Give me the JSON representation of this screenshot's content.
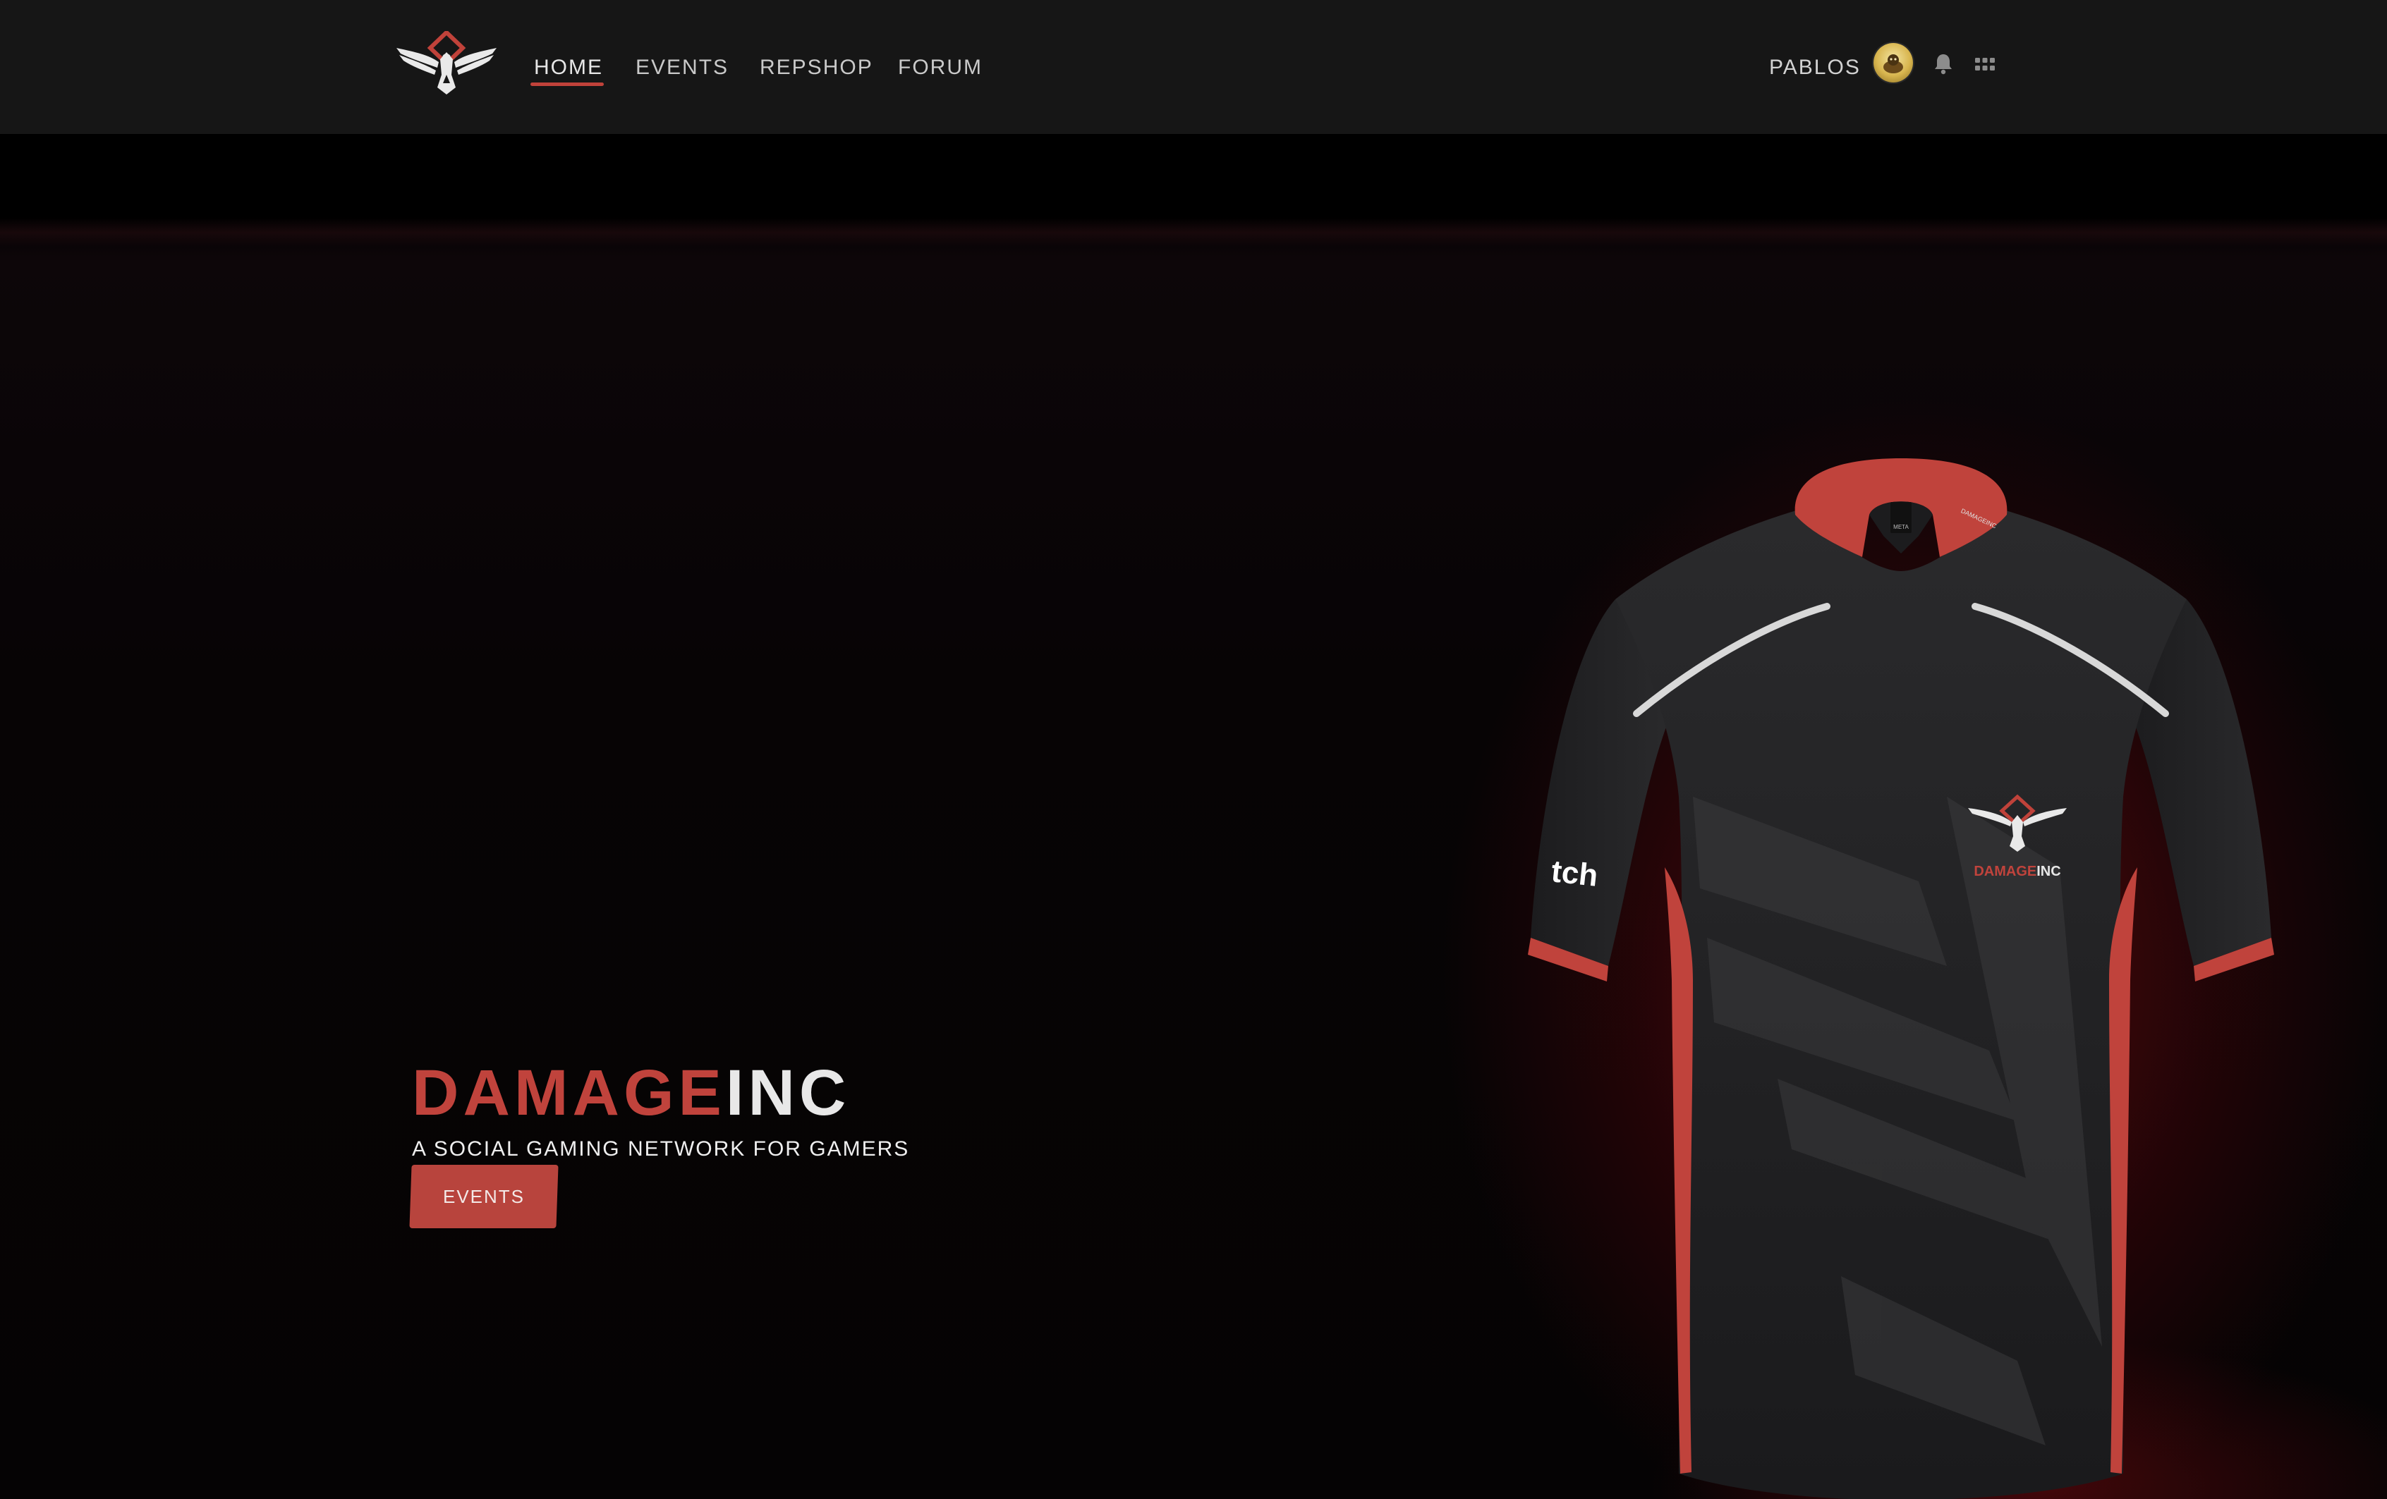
{
  "nav": {
    "items": [
      {
        "label": "HOME",
        "active": true
      },
      {
        "label": "EVENTS",
        "active": false
      },
      {
        "label": "REPSHOP",
        "active": false
      },
      {
        "label": "FORUM",
        "active": false
      }
    ],
    "username": "PABLOS",
    "icons": [
      "eagle-logo",
      "avatar",
      "bell-icon",
      "apps-grid-icon"
    ]
  },
  "hero": {
    "title_part1": "DAMAGE",
    "title_part2": "INC",
    "subtitle": "A SOCIAL GAMING NETWORK FOR GAMERS",
    "button_label": "EVENTS"
  },
  "jersey": {
    "chest_brand_part1": "DAMAGE",
    "chest_brand_part2": "INC",
    "sleeve_text": "tch",
    "collar_tag": "META",
    "collar_text": "DAMAGEINC"
  },
  "colors": {
    "accent": "#c0433c",
    "topbar": "#161616",
    "background": "#050304",
    "text_light": "#e8e8e8"
  }
}
